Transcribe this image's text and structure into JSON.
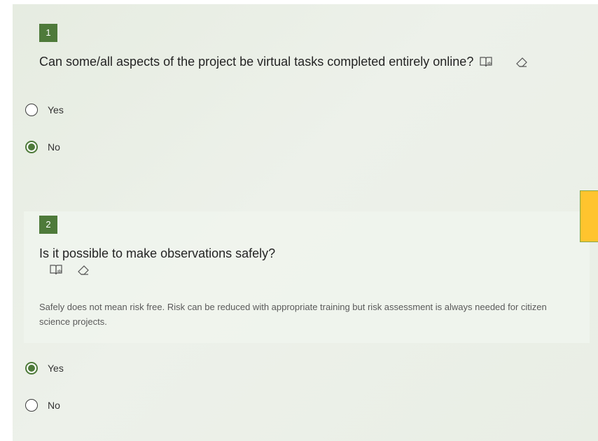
{
  "colors": {
    "accent": "#4e7a3a",
    "side_tab": "#ffc42e"
  },
  "questions": [
    {
      "number": "1",
      "title": "Can some/all aspects of the project be virtual tasks completed entirely online?",
      "icons": [
        "immersive-reader-icon",
        "eraser-icon"
      ],
      "options": [
        {
          "label": "Yes",
          "selected": false
        },
        {
          "label": "No",
          "selected": true
        }
      ]
    },
    {
      "number": "2",
      "title": "Is it possible to make observations safely?",
      "icons": [
        "immersive-reader-icon",
        "eraser-icon"
      ],
      "description": "Safely does not mean risk free. Risk can be reduced with appropriate training but risk assessment is always needed for citizen science projects.",
      "options": [
        {
          "label": "Yes",
          "selected": true
        },
        {
          "label": "No",
          "selected": false
        }
      ]
    }
  ]
}
